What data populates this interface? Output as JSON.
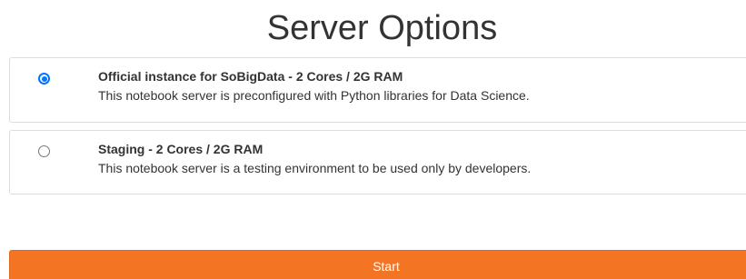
{
  "page": {
    "title": "Server Options"
  },
  "options": [
    {
      "title": "Official instance for SoBigData - 2 Cores / 2G RAM",
      "description": "This notebook server is preconfigured with Python libraries for Data Science.",
      "selected": true
    },
    {
      "title": "Staging - 2 Cores / 2G RAM",
      "description": "This notebook server is a testing environment to be used only by developers.",
      "selected": false
    }
  ],
  "actions": {
    "start_label": "Start"
  },
  "colors": {
    "accent": "#f37524",
    "radio_selected": "#0075ff",
    "border": "#dddddd",
    "text": "#333333"
  }
}
